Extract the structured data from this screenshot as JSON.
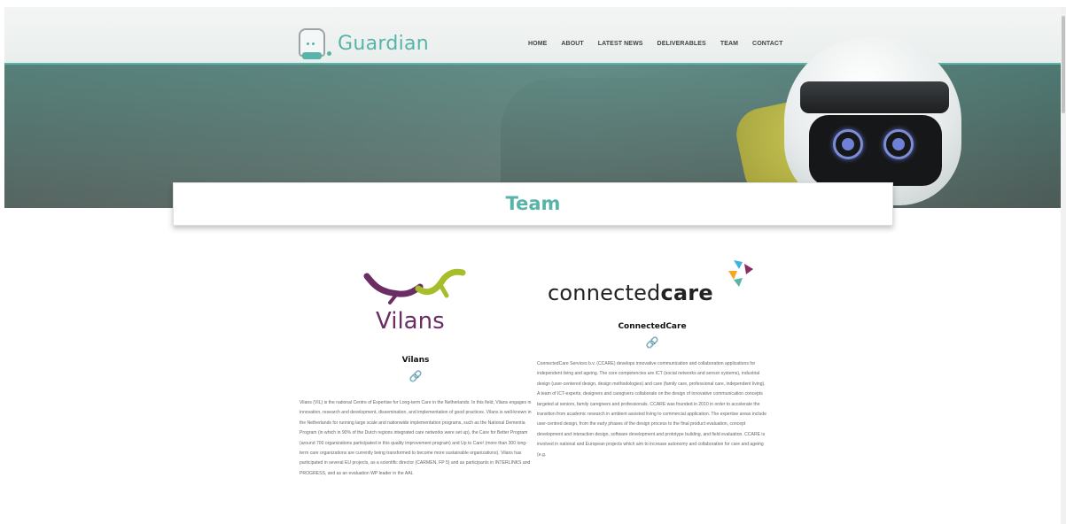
{
  "brand": {
    "name": "Guardian",
    "accent_color": "#58b4a8"
  },
  "nav": {
    "items": [
      "HOME",
      "ABOUT",
      "LATEST NEWS",
      "DELIVERABLES",
      "TEAM",
      "CONTACT"
    ]
  },
  "page_title": "Team",
  "members": [
    {
      "logo_text": "Vilans",
      "name": "Vilans",
      "link_icon": "link-icon",
      "description": "Vilans (VIL) is the national Centre of Expertise for Long-term Care in the Netherlands. In this field, Vilans engages in innovation, research and development, dissemination, and implementation of good practices. Vilans is well-known in the Netherlands for running large scale and nationwide implementation programs, such as the National Dementia Program (in which in 90% of the Dutch regions integrated care networks were set up), the Care for Better Program (around 700 organizations participated in this quality improvement program) and Up to Care! (more than 300 long-term care organizations are currently being transformed to become more sustainable organizations). Vilans has participated in several EU projects, as a scientific director (CARMEN, FP 5) and as participants in INTERLINKS and PROGRESS, and as an evaluation WP leader in the AAL"
    },
    {
      "logo_text_regular": "connected",
      "logo_text_bold": "care",
      "name": "ConnectedCare",
      "link_icon": "link-icon",
      "description": "ConnectedCare Services b.v. (CCARE) develops innovative communication and collaboration applications for independent living and ageing. The core competencies are ICT (social networks and sensor systems), industrial design (user-centered design, design methodologies) and care (family care, professional care, independent living). A team of ICT-experts, designers and caregivers collaborate on the design of innovative communication concepts targeted at seniors, family caregivers and professionals. CCARE was founded in 2010 in order to accelerate the transition from academic research in ambient assisted living to commercial application. The expertise areas include user-centred design, from the early phases of the design process to the final product evaluation, concept development and interaction design, software development and prototype building, and field evaluation. CCARE is involved in national and European projects which aim to increase autonomy and collaboration for care and ageing (e.g."
    }
  ]
}
